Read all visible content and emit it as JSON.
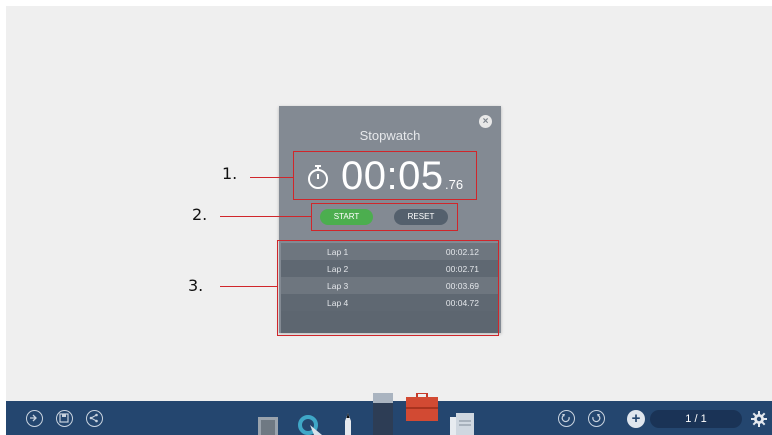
{
  "stopwatch": {
    "title": "Stopwatch",
    "close_glyph": "×",
    "time_main": "00:05",
    "time_fraction": ".76",
    "start_label": "START",
    "reset_label": "RESET",
    "laps": [
      {
        "name": "Lap 1",
        "time": "00:02.12"
      },
      {
        "name": "Lap 2",
        "time": "00:02.71"
      },
      {
        "name": "Lap 3",
        "time": "00:03.69"
      },
      {
        "name": "Lap 4",
        "time": "00:04.72"
      }
    ]
  },
  "annotations": [
    "1.",
    "2.",
    "3."
  ],
  "toolbar": {
    "page_indicator": "1 / 1",
    "plus_glyph": "+"
  },
  "colors": {
    "panel": "#838a93",
    "start_green": "#4cae4f",
    "reset_dark": "#54606d",
    "annotation_red": "#d0262b",
    "toolbar_blue": "#24466f"
  },
  "icons": [
    "timer-icon",
    "close-icon",
    "exit-icon",
    "save-icon",
    "share-icon",
    "eraser-icon",
    "pointer-icon",
    "pen-icon",
    "marker-icon",
    "toolbox-icon",
    "document-icon",
    "undo-icon",
    "redo-icon",
    "add-page-icon",
    "gear-icon"
  ]
}
